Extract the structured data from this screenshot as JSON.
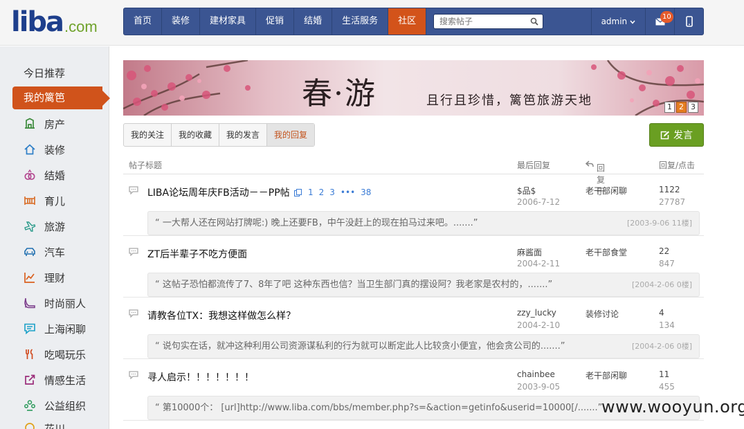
{
  "logo": {
    "main": "liba",
    "suffix": ".com"
  },
  "nav": {
    "items": [
      "首页",
      "装修",
      "建材家具",
      "促销",
      "结婚",
      "生活服务",
      "社区"
    ],
    "active": "社区",
    "search_placeholder": "搜索帖子",
    "user": "admin",
    "mail_count": "10"
  },
  "sidebar": {
    "header": "今日推荐",
    "active": "我的篱笆",
    "items": [
      "房产",
      "装修",
      "结婚",
      "育儿",
      "旅游",
      "汽车",
      "理财",
      "时尚丽人",
      "上海闲聊",
      "吃喝玩乐",
      "情感生活",
      "公益组织",
      "花川"
    ]
  },
  "banner": {
    "title": "春·游",
    "subtitle": "且行且珍惜，篱笆旅游天地",
    "pages": [
      "1",
      "2",
      "3"
    ],
    "current": "2"
  },
  "tabs": {
    "items": [
      "我的关注",
      "我的收藏",
      "我的发言",
      "我的回复"
    ],
    "active": "我的回复"
  },
  "post_button": "发言",
  "table": {
    "headers": {
      "title": "帖子标题",
      "last_reply": "最后回复",
      "reply_in": "回复于",
      "counts": "回复/点击"
    }
  },
  "rows": [
    {
      "title": "LIBA论坛周年庆FB活动－－PP帖",
      "pages": [
        "1",
        "2",
        "3",
        "•••",
        "38"
      ],
      "user": "$品$",
      "date": "2006-7-12",
      "forum": "老干部闲聊",
      "replies": "1122",
      "clicks": "27787",
      "quote": "“ 一大帮人还在网站打牌呢:) 晚上还要FB，中午没赶上的现在拍马过来吧。.......”",
      "quote_meta": "[2003-9-06 11楼]"
    },
    {
      "title": "ZT后半辈子不吃方便面",
      "pages": [],
      "user": "麻酱面",
      "date": "2004-2-11",
      "forum": "老干部食堂",
      "replies": "22",
      "clicks": "847",
      "quote": "“ 这帖子恐怕都流传了7、8年了吧 这种东西也信？当卫生部门真的摆设阿？我老家是农村的，.......”",
      "quote_meta": "[2004-2-06 0楼]"
    },
    {
      "title": "请教各位TX：我想这样做怎么样？",
      "pages": [],
      "user": "zzy_lucky",
      "date": "2004-2-10",
      "forum": "装修讨论",
      "replies": "4",
      "clicks": "134",
      "quote": "“ 说句实在话，就冲这种利用公司资源谋私利的行为就可以断定此人比较贪小便宜，他会贪公司的.......”",
      "quote_meta": "[2004-2-06 0楼]"
    },
    {
      "title": "寻人启示！！！！！！！",
      "pages": [],
      "user": "chainbee",
      "date": "2003-9-05",
      "forum": "老干部闲聊",
      "replies": "11",
      "clicks": "455",
      "quote": "“ 第10000个： [url]http://www.liba.com/bbs/member.php?s=&action=getinfo&userid=10000[/.......”",
      "quote_meta": ""
    }
  ],
  "watermark": "www.wooyun.org"
}
